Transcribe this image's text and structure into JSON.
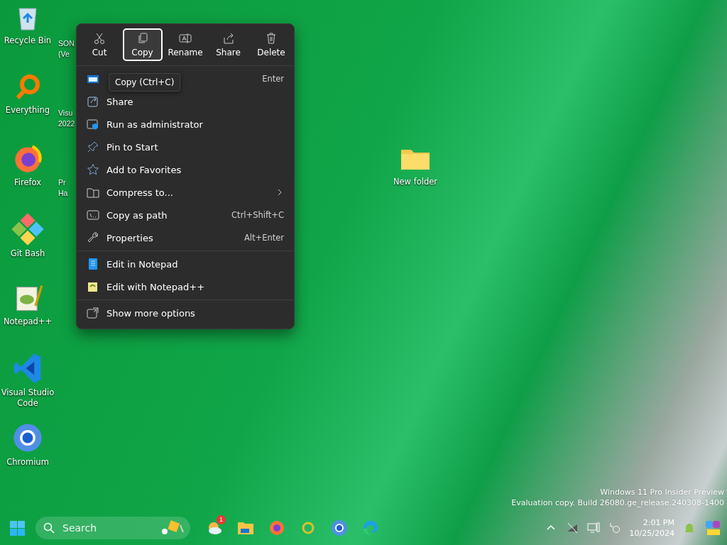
{
  "desktop_icons": [
    {
      "label": "Recycle Bin"
    },
    {
      "label": "Everything"
    },
    {
      "label": "Firefox"
    },
    {
      "label": "Git Bash"
    },
    {
      "label": "Notepad++"
    },
    {
      "label": "Visual Studio Code"
    },
    {
      "label": "Chromium"
    }
  ],
  "partial_icons": [
    {
      "lines": [
        "SON",
        "(Ve"
      ]
    },
    {
      "lines": [
        "Visu",
        "2022"
      ]
    },
    {
      "lines": [
        "Pr",
        "Ha"
      ]
    }
  ],
  "folder": {
    "label": "New folder"
  },
  "context_menu": {
    "toolbar": [
      {
        "label": "Cut",
        "selected": false
      },
      {
        "label": "Copy",
        "selected": true
      },
      {
        "label": "Rename",
        "selected": false
      },
      {
        "label": "Share",
        "selected": false
      },
      {
        "label": "Delete",
        "selected": false
      }
    ],
    "groups": [
      [
        {
          "shortcut": "Enter"
        },
        {
          "label": "Share"
        },
        {
          "label": "Run as administrator"
        },
        {
          "label": "Pin to Start"
        },
        {
          "label": "Add to Favorites"
        },
        {
          "label": "Compress to...",
          "submenu": true
        },
        {
          "label": "Copy as path",
          "shortcut": "Ctrl+Shift+C"
        },
        {
          "label": "Properties",
          "shortcut": "Alt+Enter"
        }
      ],
      [
        {
          "label": "Edit in Notepad"
        },
        {
          "label": "Edit with Notepad++"
        }
      ],
      [
        {
          "label": "Show more options"
        }
      ]
    ]
  },
  "tooltip": "Copy (Ctrl+C)",
  "watermark": [
    "Windows 11 Pro Insider Preview",
    "Evaluation copy. Build 26080.ge_release.240308-1400"
  ],
  "taskbar": {
    "search": {
      "placeholder": "Search"
    },
    "badge": "1",
    "time": "2:01 PM",
    "date": "10/25/2024"
  }
}
